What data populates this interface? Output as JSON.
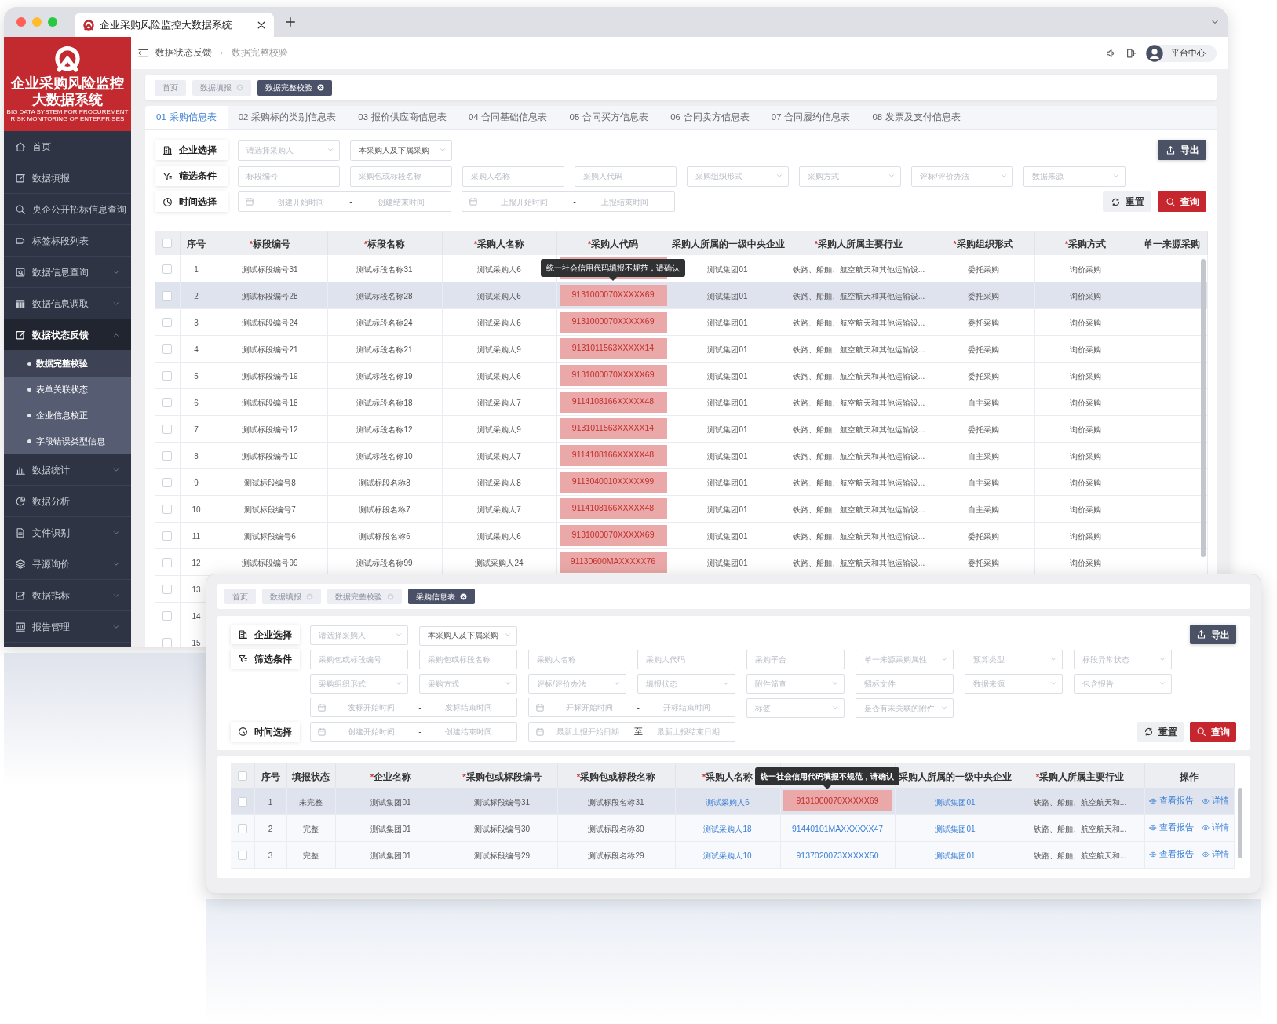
{
  "browser": {
    "tab_title": "企业采购风险监控大数据系统"
  },
  "sidebar": {
    "logo": {
      "title": [
        "企业采购风险监控",
        "大数据系统"
      ],
      "subtitle": [
        "BIG DATA SYSTEM FOR PROCUREMENT",
        "RISK MONITORING OF ENTERPRISES"
      ]
    },
    "items": [
      {
        "label": "首页",
        "expandable": false,
        "expanded": false
      },
      {
        "label": "数据填报",
        "expandable": false,
        "expanded": false
      },
      {
        "label": "央企公开招标信息查询",
        "expandable": false,
        "expanded": false
      },
      {
        "label": "标签标段列表",
        "expandable": false,
        "expanded": false
      },
      {
        "label": "数据信息查询",
        "expandable": true,
        "expanded": false
      },
      {
        "label": "数据信息调取",
        "expandable": true,
        "expanded": false
      },
      {
        "label": "数据状态反馈",
        "expandable": true,
        "expanded": true,
        "children": [
          {
            "label": "数据完整校验",
            "selected": true
          },
          {
            "label": "表单关联状态",
            "selected": false
          },
          {
            "label": "企业信息校正",
            "selected": false
          },
          {
            "label": "字段错误类型信息",
            "selected": false
          }
        ]
      },
      {
        "label": "数据统计",
        "expandable": true,
        "expanded": false
      },
      {
        "label": "数据分析",
        "expandable": false,
        "expanded": false
      },
      {
        "label": "文件识别",
        "expandable": true,
        "expanded": false
      },
      {
        "label": "寻源询价",
        "expandable": true,
        "expanded": false
      },
      {
        "label": "数据指标",
        "expandable": true,
        "expanded": false
      },
      {
        "label": "报告管理",
        "expandable": true,
        "expanded": false
      }
    ]
  },
  "header": {
    "breadcrumb": [
      "数据状态反馈",
      "数据完整校验"
    ],
    "user": "平台中心"
  },
  "tags": [
    {
      "label": "首页",
      "closable": false,
      "selected": false
    },
    {
      "label": "数据填报",
      "closable": true,
      "selected": false
    },
    {
      "label": "数据完整校验",
      "closable": true,
      "selected": true
    }
  ],
  "tabs": [
    {
      "label": "01-采购信息表",
      "selected": true
    },
    {
      "label": "02-采购标的类别信息表",
      "selected": false
    },
    {
      "label": "03-报价供应商信息表",
      "selected": false
    },
    {
      "label": "04-合同基础信息表",
      "selected": false
    },
    {
      "label": "05-合同买方信息表",
      "selected": false
    },
    {
      "label": "06-合同卖方信息表",
      "selected": false
    },
    {
      "label": "07-合同履约信息表",
      "selected": false
    },
    {
      "label": "08-发票及支付信息表",
      "selected": false
    }
  ],
  "filters": [
    {
      "label": "企业选择",
      "kind": "company",
      "fields": [
        {
          "kind": "select",
          "placeholder": "请选择采购人"
        },
        {
          "kind": "select",
          "value": "本采购人及下属采购"
        }
      ]
    },
    {
      "label": "筛选条件",
      "kind": "filter",
      "fields": [
        {
          "kind": "input",
          "placeholder": "标段编号"
        },
        {
          "kind": "input",
          "placeholder": "采购包或标段名称"
        },
        {
          "kind": "input",
          "placeholder": "采购人名称"
        },
        {
          "kind": "input",
          "placeholder": "采购人代码"
        },
        {
          "kind": "select",
          "placeholder": "采购组织形式"
        },
        {
          "kind": "select",
          "placeholder": "采购方式"
        },
        {
          "kind": "select",
          "placeholder": "评标/评价办法"
        },
        {
          "kind": "select",
          "placeholder": "数据来源"
        }
      ]
    },
    {
      "label": "时间选择",
      "kind": "time",
      "fields": [
        {
          "kind": "daterange",
          "start": {
            "placeholder": "创建开始时间"
          },
          "separator": "-",
          "end": {
            "placeholder": "创建结束时间"
          }
        },
        {
          "kind": "daterange",
          "start": {
            "placeholder": "上报开始时间"
          },
          "separator": "-",
          "end": {
            "placeholder": "上报结束时间"
          }
        }
      ]
    }
  ],
  "actions": {
    "export": "导出",
    "reset": "重置",
    "query": "查询"
  },
  "table": {
    "required_mark": "*",
    "all_checked": false,
    "tooltip": {
      "text": "统一社会信用代码填报不规范，请确认",
      "kind": "row"
    },
    "columns": [
      {
        "label": "序号",
        "required": false,
        "kind": "text"
      },
      {
        "label": "标段编号",
        "required": true,
        "kind": "text"
      },
      {
        "label": "标段名称",
        "required": true,
        "kind": "text"
      },
      {
        "label": "采购人名称",
        "required": true,
        "kind": "text"
      },
      {
        "label": "采购人代码",
        "required": true,
        "kind": "code"
      },
      {
        "label": "采购人所属的一级中央企业",
        "required": false,
        "kind": "text"
      },
      {
        "label": "采购人所属主要行业",
        "required": true,
        "kind": "text"
      },
      {
        "label": "采购组织形式",
        "required": true,
        "kind": "text"
      },
      {
        "label": "采购方式",
        "required": true,
        "kind": "text"
      },
      {
        "label": "单一来源采购",
        "required": false,
        "kind": "text"
      }
    ],
    "rows": [
      {
        "checked": false,
        "selected": false,
        "flagged": true,
        "cells": [
          "1",
          "测试标段编号31",
          "测试标段名称31",
          "测试采购人6",
          null,
          "测试集团01",
          "铁路、船舶、航空航天和其他运输设...",
          "委托采购",
          "询价采购",
          null
        ]
      },
      {
        "checked": false,
        "selected": true,
        "flagged": true,
        "cells": [
          "2",
          "测试标段编号28",
          "测试标段名称28",
          "测试采购人6",
          "9131000070XXXXX69",
          "测试集团01",
          "铁路、船舶、航空航天和其他运输设...",
          "委托采购",
          "询价采购",
          null
        ]
      },
      {
        "checked": false,
        "selected": false,
        "flagged": true,
        "cells": [
          "3",
          "测试标段编号24",
          "测试标段名称24",
          "测试采购人6",
          "9131000070XXXXX69",
          "测试集团01",
          "铁路、船舶、航空航天和其他运输设...",
          "委托采购",
          "询价采购",
          null
        ]
      },
      {
        "checked": false,
        "selected": false,
        "flagged": true,
        "cells": [
          "4",
          "测试标段编号21",
          "测试标段名称21",
          "测试采购人9",
          "9131011563XXXXX14",
          "测试集团01",
          "铁路、船舶、航空航天和其他运输设...",
          "委托采购",
          "询价采购",
          null
        ]
      },
      {
        "checked": false,
        "selected": false,
        "flagged": true,
        "cells": [
          "5",
          "测试标段编号19",
          "测试标段名称19",
          "测试采购人6",
          "9131000070XXXXX69",
          "测试集团01",
          "铁路、船舶、航空航天和其他运输设...",
          "委托采购",
          "询价采购",
          null
        ]
      },
      {
        "checked": false,
        "selected": false,
        "flagged": true,
        "cells": [
          "6",
          "测试标段编号18",
          "测试标段名称18",
          "测试采购人7",
          "9114108166XXXXX48",
          "测试集团01",
          "铁路、船舶、航空航天和其他运输设...",
          "自主采购",
          "询价采购",
          null
        ]
      },
      {
        "checked": false,
        "selected": false,
        "flagged": true,
        "cells": [
          "7",
          "测试标段编号12",
          "测试标段名称12",
          "测试采购人9",
          "9131011563XXXXX14",
          "测试集团01",
          "铁路、船舶、航空航天和其他运输设...",
          "委托采购",
          "询价采购",
          null
        ]
      },
      {
        "checked": false,
        "selected": false,
        "flagged": true,
        "cells": [
          "8",
          "测试标段编号10",
          "测试标段名称10",
          "测试采购人7",
          "9114108166XXXXX48",
          "测试集团01",
          "铁路、船舶、航空航天和其他运输设...",
          "自主采购",
          "询价采购",
          null
        ]
      },
      {
        "checked": false,
        "selected": false,
        "flagged": true,
        "cells": [
          "9",
          "测试标段编号8",
          "测试标段名称8",
          "测试采购人8",
          "9113040010XXXXX99",
          "测试集团01",
          "铁路、船舶、航空航天和其他运输设...",
          "自主采购",
          "询价采购",
          null
        ]
      },
      {
        "checked": false,
        "selected": false,
        "flagged": true,
        "cells": [
          "10",
          "测试标段编号7",
          "测试标段名称7",
          "测试采购人7",
          "9114108166XXXXX48",
          "测试集团01",
          "铁路、船舶、航空航天和其他运输设...",
          "自主采购",
          "询价采购",
          null
        ]
      },
      {
        "checked": false,
        "selected": false,
        "flagged": true,
        "cells": [
          "11",
          "测试标段编号6",
          "测试标段名称6",
          "测试采购人6",
          "9131000070XXXXX69",
          "测试集团01",
          "铁路、船舶、航空航天和其他运输设...",
          "委托采购",
          "询价采购",
          null
        ]
      },
      {
        "checked": false,
        "selected": false,
        "flagged": true,
        "cells": [
          "12",
          "测试标段编号99",
          "测试标段名称99",
          "测试采购人24",
          "91130600MAXXXXX76",
          "测试集团01",
          "铁路、船舶、航空航天和其他运输设...",
          "委托采购",
          "询价采购",
          null
        ]
      },
      {
        "checked": false,
        "selected": false,
        "cells": [
          "13",
          null,
          null,
          null,
          null,
          null,
          null,
          null,
          null,
          null
        ]
      },
      {
        "checked": false,
        "selected": false,
        "cells": [
          "14",
          null,
          null,
          null,
          null,
          null,
          null,
          null,
          null,
          null
        ]
      },
      {
        "checked": false,
        "selected": false,
        "cells": [
          "15",
          null,
          null,
          null,
          null,
          null,
          null,
          null,
          null,
          null
        ]
      }
    ]
  },
  "overlay": {
    "tags": [
      {
        "label": "首页",
        "closable": false,
        "selected": false
      },
      {
        "label": "数据填报",
        "closable": true,
        "selected": false
      },
      {
        "label": "数据完整校验",
        "closable": true,
        "selected": false
      },
      {
        "label": "采购信息表",
        "closable": true,
        "selected": true
      }
    ],
    "filters": [
      {
        "label": "企业选择",
        "kind": "company",
        "fields": [
          {
            "kind": "select",
            "placeholder": "请选择采购人"
          },
          {
            "kind": "select",
            "value": "本采购人及下属采购"
          }
        ]
      },
      {
        "label": "筛选条件",
        "kind": "filter",
        "fields": [
          {
            "kind": "input",
            "placeholder": "采购包或标段编号"
          },
          {
            "kind": "input",
            "placeholder": "采购包或标段名称"
          },
          {
            "kind": "input",
            "placeholder": "采购人名称"
          },
          {
            "kind": "input",
            "placeholder": "采购人代码"
          },
          {
            "kind": "input",
            "placeholder": "采购平台"
          },
          {
            "kind": "select",
            "placeholder": "单一来源采购属性"
          },
          {
            "kind": "select",
            "placeholder": "预算类型"
          },
          {
            "kind": "select",
            "placeholder": "标段异常状态"
          }
        ]
      },
      {
        "fields": [
          {
            "kind": "select",
            "placeholder": "采购组织形式"
          },
          {
            "kind": "select",
            "placeholder": "采购方式"
          },
          {
            "kind": "select",
            "placeholder": "评标/评价办法"
          },
          {
            "kind": "select",
            "placeholder": "填报状态"
          },
          {
            "kind": "select",
            "placeholder": "附件筛查"
          },
          {
            "kind": "input",
            "placeholder": "招标文件"
          },
          {
            "kind": "select",
            "placeholder": "数据来源"
          },
          {
            "kind": "select",
            "placeholder": "包含报告"
          }
        ]
      },
      {
        "fields": [
          {
            "kind": "daterange",
            "start": {
              "placeholder": "发标开始时间"
            },
            "separator": "-",
            "end": {
              "placeholder": "发标结束时间"
            }
          },
          {
            "kind": "daterange",
            "start": {
              "placeholder": "开标开始时间"
            },
            "separator": "-",
            "end": {
              "placeholder": "开标结束时间"
            }
          },
          {
            "kind": "select",
            "placeholder": "标签"
          },
          {
            "kind": "select",
            "placeholder": "是否有未关联的附件"
          }
        ]
      },
      {
        "label": "时间选择",
        "kind": "time",
        "fields": [
          {
            "kind": "daterange",
            "start": {
              "placeholder": "创建开始时间"
            },
            "separator": "-",
            "end": {
              "placeholder": "创建结束时间"
            }
          },
          {
            "kind": "daterange",
            "start": {
              "placeholder": "最新上报开始日期"
            },
            "separator": "至",
            "end": {
              "placeholder": "最新上报结束日期"
            }
          }
        ]
      }
    ],
    "actions": {
      "export": "导出",
      "reset": "重置",
      "query": "查询"
    },
    "table": {
      "required_mark": "*",
      "all_checked": false,
      "tooltip": {
        "text": "统一社会信用代码填报不规范，请确认",
        "kind": "header"
      },
      "columns": [
        {
          "label": "序号",
          "required": false,
          "kind": "text"
        },
        {
          "label": "填报状态",
          "required": false,
          "kind": "text"
        },
        {
          "label": "企业名称",
          "required": true,
          "kind": "text"
        },
        {
          "label": "采购包或标段编号",
          "required": true,
          "kind": "text"
        },
        {
          "label": "采购包或标段名称",
          "required": true,
          "kind": "text"
        },
        {
          "label": "采购人名称",
          "required": true,
          "kind": "link"
        },
        {
          "kind": "code"
        },
        {
          "label": "采购人所属的一级中央企业",
          "required": false,
          "kind": "link"
        },
        {
          "label": "采购人所属主要行业",
          "required": true,
          "kind": "text"
        },
        {
          "label": "操作",
          "required": false,
          "kind": "actions"
        }
      ],
      "rows": [
        {
          "checked": false,
          "selected": true,
          "flagged": true,
          "cells": [
            "1",
            "未完整",
            "测试集团01",
            "测试标段编号31",
            "测试标段名称31",
            "测试采购人6",
            "9131000070XXXXX69",
            "测试集团01",
            "铁路、船舶、航空航天和...",
            [
              "查看报告",
              "详情"
            ]
          ]
        },
        {
          "checked": false,
          "selected": false,
          "flagged": false,
          "cells": [
            "2",
            "完整",
            "测试集团01",
            "测试标段编号30",
            "测试标段名称30",
            "测试采购人18",
            "91440101MAXXXXXX47",
            "测试集团01",
            "铁路、船舶、航空航天和...",
            [
              "查看报告",
              "详情"
            ]
          ]
        },
        {
          "checked": false,
          "selected": false,
          "flagged": false,
          "cells": [
            "3",
            "完整",
            "测试集团01",
            "测试标段编号29",
            "测试标段名称29",
            "测试采购人10",
            "9137020073XXXXX50",
            "测试集团01",
            "铁路、船舶、航空航天和...",
            [
              "查看报告",
              "详情"
            ]
          ]
        }
      ]
    }
  }
}
